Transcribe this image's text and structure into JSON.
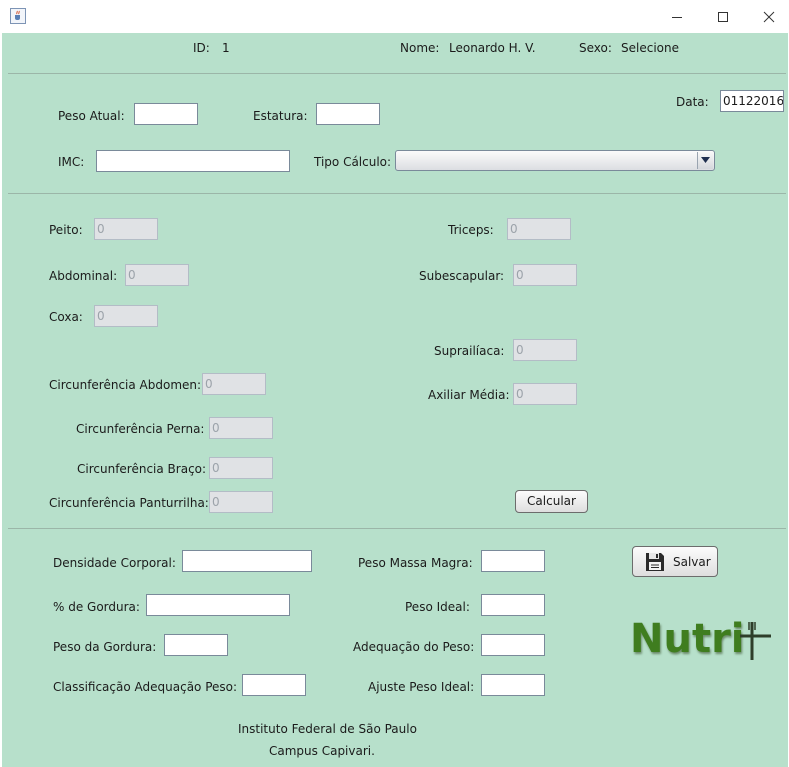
{
  "header": {
    "id_label": "ID:",
    "id_value": "1",
    "nome_label": "Nome:",
    "nome_value": "Leonardo H. V.",
    "sexo_label": "Sexo:",
    "sexo_value": "Selecione"
  },
  "top": {
    "peso_atual_label": "Peso Atual:",
    "peso_atual_value": "",
    "estatura_label": "Estatura:",
    "estatura_value": "",
    "data_label": "Data:",
    "data_value": "01122016",
    "imc_label": "IMC:",
    "imc_value": "",
    "tipo_calculo_label": "Tipo Cálculo:",
    "tipo_calculo_value": ""
  },
  "measures": {
    "peito": {
      "label": "Peito:",
      "value": "0"
    },
    "abdominal": {
      "label": "Abdominal:",
      "value": "0"
    },
    "coxa": {
      "label": "Coxa:",
      "value": "0"
    },
    "circ_abdomen": {
      "label": "Circunferência Abdomen:",
      "value": "0"
    },
    "circ_perna": {
      "label": "Circunferência Perna:",
      "value": "0"
    },
    "circ_braco": {
      "label": "Circunferência Braço:",
      "value": "0"
    },
    "circ_panturrilha": {
      "label": "Circunferência Panturrilha:",
      "value": "0"
    },
    "triceps": {
      "label": "Triceps:",
      "value": "0"
    },
    "subescapular": {
      "label": "Subescapular:",
      "value": "0"
    },
    "suprailiaca": {
      "label": "Suprailíaca:",
      "value": "0"
    },
    "axiliar_media": {
      "label": "Axiliar Média:",
      "value": "0"
    },
    "calcular_label": "Calcular"
  },
  "results": {
    "densidade_label": "Densidade Corporal:",
    "densidade_value": "",
    "gordura_pct_label": "% de Gordura:",
    "gordura_pct_value": "",
    "peso_gordura_label": "Peso da Gordura:",
    "peso_gordura_value": "",
    "classificacao_label": "Classificação Adequação Peso:",
    "classificacao_value": "",
    "massa_magra_label": "Peso Massa Magra:",
    "massa_magra_value": "",
    "peso_ideal_label": "Peso Ideal:",
    "peso_ideal_value": "",
    "adequacao_label": "Adequação do Peso:",
    "adequacao_value": "",
    "ajuste_label": "Ajuste Peso Ideal:",
    "ajuste_value": "",
    "salvar_label": "Salvar"
  },
  "logo_text": "Nutri",
  "footer": {
    "line1": "Instituto Federal de São Paulo",
    "line2": "Campus Capivari."
  },
  "icons": {
    "app": "java-cup-icon",
    "save": "floppy-disk-icon",
    "minimize": "minimize-icon",
    "maximize": "maximize-icon",
    "close": "close-icon",
    "combo_arrow": "chevron-down-icon",
    "logo_mark": "fork-knife-cross-icon"
  },
  "colors": {
    "background": "#b7e0cb",
    "logo_green": "#3f7d1f",
    "disabled_field": "#e0e2e5"
  }
}
